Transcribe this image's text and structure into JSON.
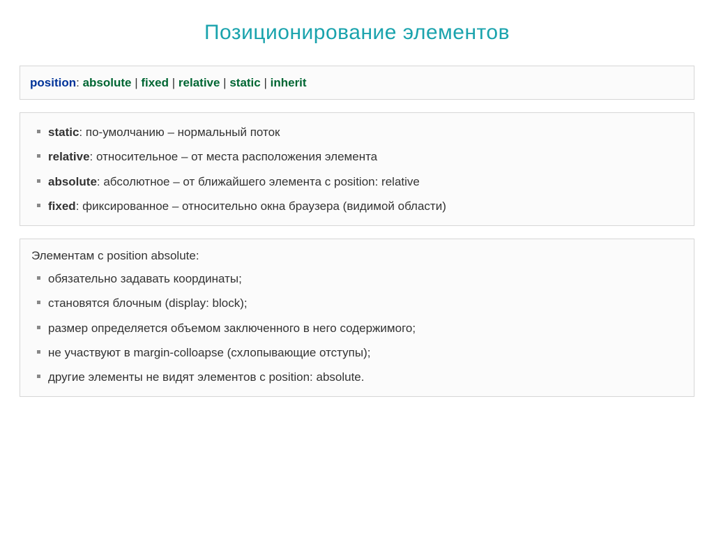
{
  "title": "Позиционирование элементов",
  "syntax": {
    "property": "position",
    "separator": ": ",
    "pipe": " | ",
    "values": [
      "absolute",
      "fixed",
      "relative",
      "static",
      "inherit"
    ]
  },
  "definitions": [
    {
      "keyword": "static",
      "text": ": по-умолчанию – нормальный поток"
    },
    {
      "keyword": "relative",
      "text": ": относительное – от места расположения элемента"
    },
    {
      "keyword": "absolute",
      "text": ": абсолютное – от ближайшего элемента с position: relative"
    },
    {
      "keyword": "fixed",
      "text": ": фиксированное – относительно окна браузера (видимой области)"
    }
  ],
  "notes": {
    "intro": "Элементам с position absolute:",
    "items": [
      "обязательно задавать координаты;",
      "становятся блочным (display: block);",
      "размер определяется объемом заключенного в него содержимого;",
      "не участвуют в margin-colloapse (схлопывающие отступы);",
      "другие элементы не видят элементов с position: absolute."
    ]
  }
}
